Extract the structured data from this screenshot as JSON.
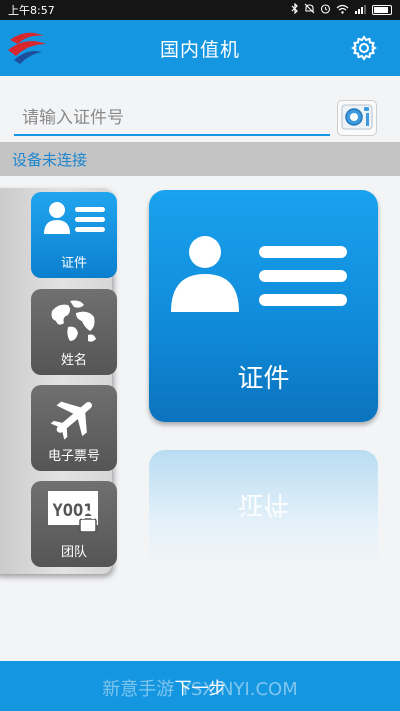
{
  "status_bar": {
    "time": "上午8:57"
  },
  "header": {
    "title": "国内值机"
  },
  "search": {
    "placeholder": "请输入证件号",
    "value": ""
  },
  "connection_status": "设备未连接",
  "side_menu": [
    {
      "label": "证件",
      "icon": "id-card-icon",
      "active": true
    },
    {
      "label": "姓名",
      "icon": "globe-icon",
      "active": false
    },
    {
      "label": "电子票号",
      "icon": "airplane-icon",
      "active": false
    },
    {
      "label": "团队",
      "icon": "group-lock-icon",
      "active": false
    }
  ],
  "selected_card": {
    "label": "证件",
    "icon": "id-card-icon"
  },
  "footer": {
    "next_label": "下一步"
  },
  "watermark": "新意手游 YSXINYI.COM",
  "group_icon_text": "YOO1",
  "colors": {
    "primary": "#1596e1",
    "active": "#0f8ad9",
    "inactive": "#5e5e5e",
    "status_text": "#1c86cf"
  }
}
